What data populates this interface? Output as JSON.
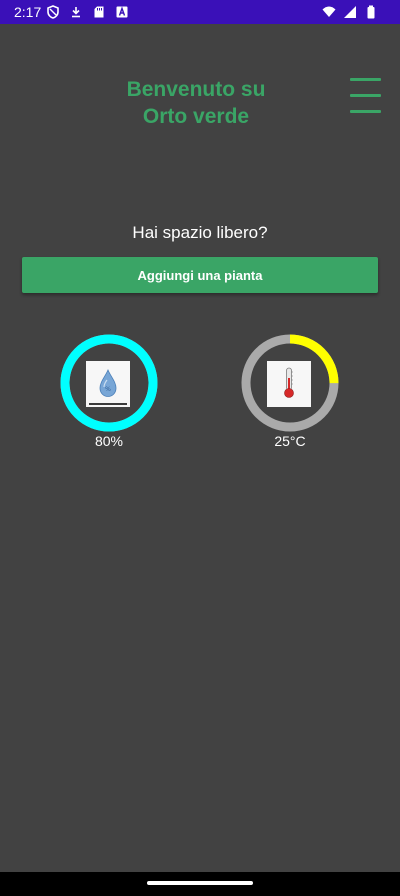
{
  "status_bar": {
    "time": "2:17",
    "icons": [
      "vpn-shield-icon",
      "download-icon",
      "sd-card-icon",
      "a-letter-icon",
      "wifi-icon",
      "signal-icon",
      "battery-icon"
    ],
    "background": "#3a10b8"
  },
  "header": {
    "title_line1": "Benvenuto su",
    "title_line2": "Orto verde",
    "menu_icon": "hamburger-menu-icon"
  },
  "main": {
    "question": "Hai spazio libero?",
    "add_button_label": "Aggiungi una pianta",
    "humidity": {
      "label": "80%",
      "percent": 100,
      "icon": "water-drop-icon",
      "color": "#00ffff"
    },
    "temperature": {
      "label": "25°C",
      "percent": 25,
      "icon": "thermometer-icon",
      "color": "#ffff00"
    }
  },
  "colors": {
    "background": "#424242",
    "accent": "#3aa566",
    "ring_track": "#aaaaaa",
    "nav_bar": "#000000"
  }
}
